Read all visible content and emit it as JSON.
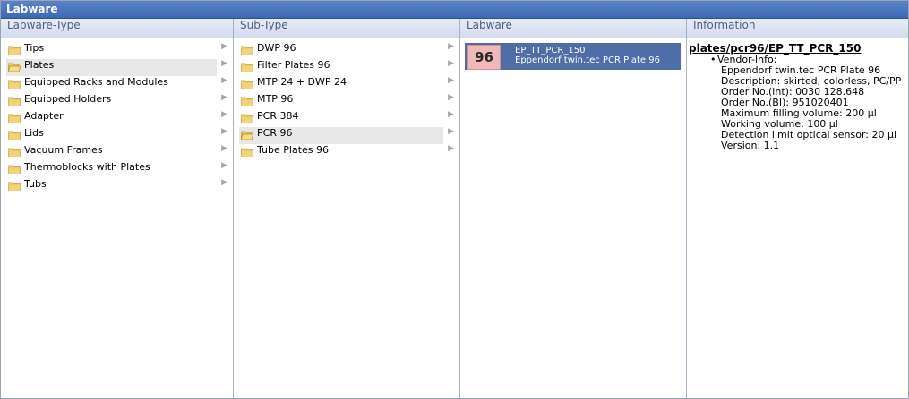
{
  "window": {
    "title": "Labware"
  },
  "columns": {
    "type": {
      "header": "Labware-Type"
    },
    "subtype": {
      "header": "Sub-Type"
    },
    "labware": {
      "header": "Labware"
    },
    "information": {
      "header": "Information"
    }
  },
  "labware_types": [
    {
      "label": "Tips",
      "selected": false
    },
    {
      "label": "Plates",
      "selected": true
    },
    {
      "label": "Equipped Racks and Modules",
      "selected": false
    },
    {
      "label": "Equipped Holders",
      "selected": false
    },
    {
      "label": "Adapter",
      "selected": false
    },
    {
      "label": "Lids",
      "selected": false
    },
    {
      "label": "Vacuum Frames",
      "selected": false
    },
    {
      "label": "Thermoblocks with Plates",
      "selected": false
    },
    {
      "label": "Tubs",
      "selected": false
    }
  ],
  "sub_types": [
    {
      "label": "DWP 96",
      "selected": false
    },
    {
      "label": "Filter Plates 96",
      "selected": false
    },
    {
      "label": "MTP 24 + DWP 24",
      "selected": false
    },
    {
      "label": "MTP 96",
      "selected": false
    },
    {
      "label": "PCR 384",
      "selected": false
    },
    {
      "label": "PCR 96",
      "selected": true
    },
    {
      "label": "Tube Plates 96",
      "selected": false
    }
  ],
  "labware_item": {
    "badge": "96",
    "id": "EP_TT_PCR_150",
    "name": "Eppendorf twin.tec PCR Plate 96",
    "selected": true
  },
  "information": {
    "path": "plates/pcr96/EP_TT_PCR_150",
    "vendor_label": "Vendor-Info:",
    "lines": [
      "Eppendorf twin.tec PCR Plate 96",
      "Description: skirted, colorless, PC/PP",
      "Order No.(int): 0030 128.648",
      "Order No.(BI): 951020401",
      "Maximum filling volume: 200 µl",
      "Working volume: 100 µl",
      "Detection limit optical sensor: 20 µl",
      "Version: 1.1"
    ]
  },
  "icons": {
    "folder": "folder-icon",
    "folder_open": "folder-open-icon",
    "chevron": "chevron-right-icon"
  },
  "colors": {
    "title_bar": "#3e68b3",
    "selection": "#4f6ea8",
    "badge": "#efb9b9"
  }
}
